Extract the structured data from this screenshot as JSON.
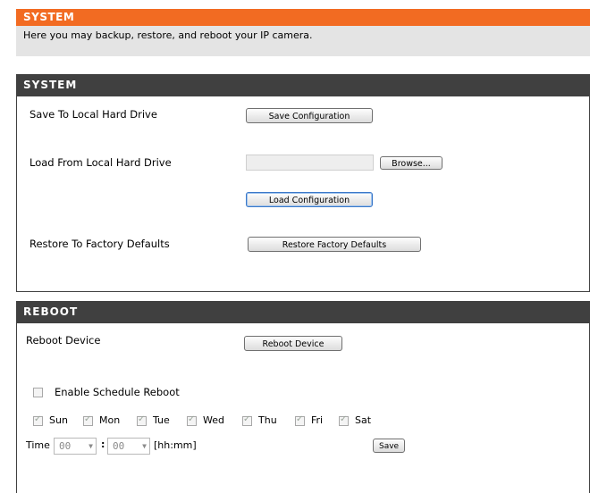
{
  "top_panel": {
    "title": "SYSTEM",
    "description": "Here you may backup, restore, and reboot your IP camera."
  },
  "system": {
    "title": "SYSTEM",
    "save_label": "Save To Local Hard Drive",
    "save_button": "Save Configuration",
    "load_label": "Load From Local Hard Drive",
    "browse_button": "Browse...",
    "load_button": "Load Configuration",
    "restore_label": "Restore To Factory Defaults",
    "restore_button": "Restore Factory Defaults"
  },
  "reboot": {
    "title": "REBOOT",
    "reboot_label": "Reboot Device",
    "reboot_button": "Reboot Device",
    "schedule_label": "Enable Schedule Reboot",
    "days": [
      "Sun",
      "Mon",
      "Tue",
      "Wed",
      "Thu",
      "Fri",
      "Sat"
    ],
    "time_label": "Time",
    "hour_value": "00",
    "minute_value": "00",
    "separator": ":",
    "format_hint": "[hh:mm]",
    "save_button": "Save"
  },
  "colors": {
    "accent": "#f26b22",
    "section_header": "#404040"
  }
}
